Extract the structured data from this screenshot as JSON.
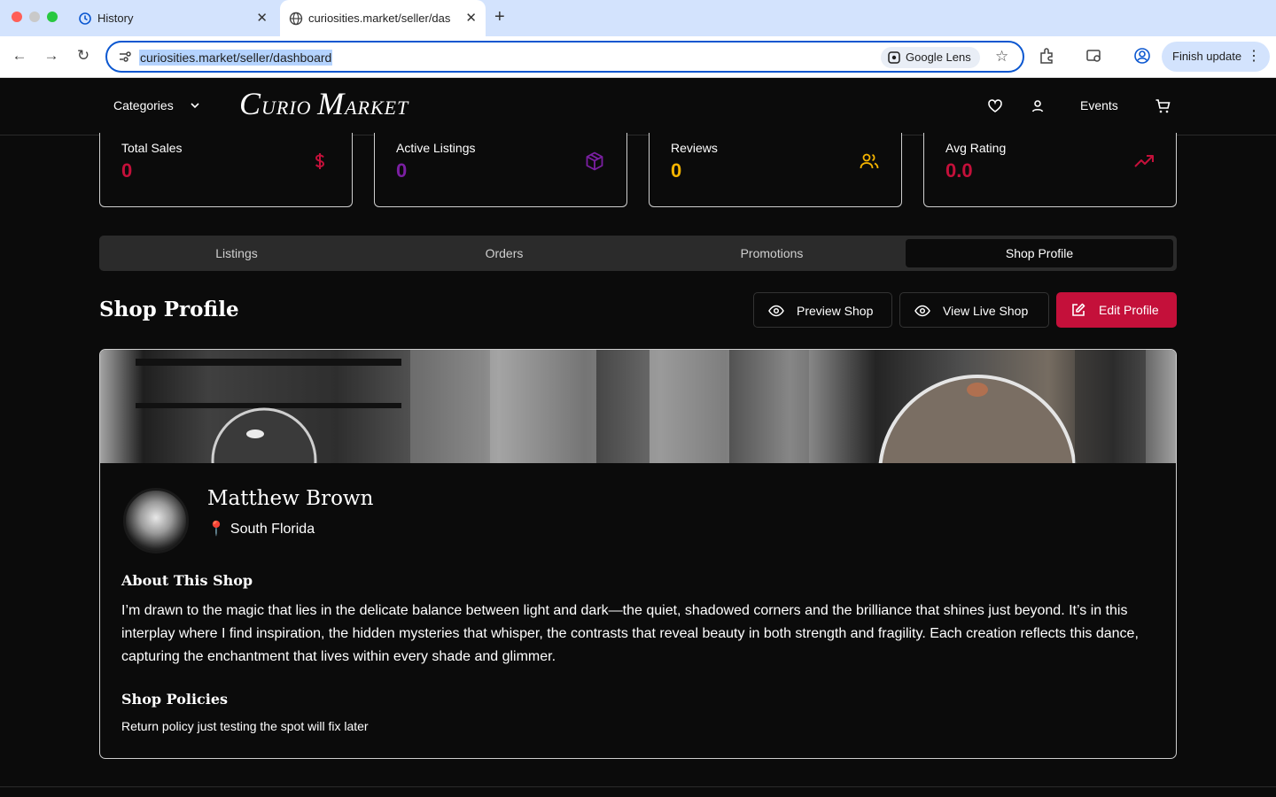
{
  "browser": {
    "tabs": [
      {
        "title": "History",
        "icon": "history-icon"
      },
      {
        "title": "curiosities.market/seller/dash",
        "icon": "globe-icon"
      }
    ],
    "url": "curiosities.market/seller/dashboard",
    "lens_label": "Google Lens",
    "finish_update_label": "Finish update"
  },
  "site": {
    "categories_label": "Categories",
    "logo_text": {
      "c": "C",
      "urio": "URIO ",
      "m": "M",
      "arket": "ARKET"
    },
    "events_label": "Events"
  },
  "stats": [
    {
      "label": "Total Sales",
      "value": "0",
      "icon": "dollar-icon",
      "color": "#c4103a"
    },
    {
      "label": "Active Listings",
      "value": "0",
      "icon": "package-icon",
      "color": "#7b1fa2"
    },
    {
      "label": "Reviews",
      "value": "0",
      "icon": "users-icon",
      "color": "#f5b400"
    },
    {
      "label": "Avg Rating",
      "value": "0.0",
      "icon": "trending-up-icon",
      "color": "#c4103a"
    }
  ],
  "tabs": [
    "Listings",
    "Orders",
    "Promotions",
    "Shop Profile"
  ],
  "active_tab": "Shop Profile",
  "section": {
    "title": "Shop Profile",
    "preview_label": "Preview Shop",
    "live_label": "View Live Shop",
    "edit_label": "Edit Profile"
  },
  "profile": {
    "name": "Matthew Brown",
    "location": "South Florida",
    "about_heading": "About This Shop",
    "about": "I’m drawn to the magic that lies in the delicate balance between light and dark—the quiet, shadowed corners and the brilliance that shines just beyond. It’s in this interplay where I find inspiration, the hidden mysteries that whisper, the contrasts that reveal beauty in both strength and fragility. Each creation reflects this dance, capturing the enchantment that lives within every shade and glimmer.",
    "policies_heading": "Shop Policies",
    "policies": "Return policy just testing the spot will fix later"
  },
  "colors": {
    "accent": "#c4103a",
    "bg": "#0b0b0b"
  }
}
